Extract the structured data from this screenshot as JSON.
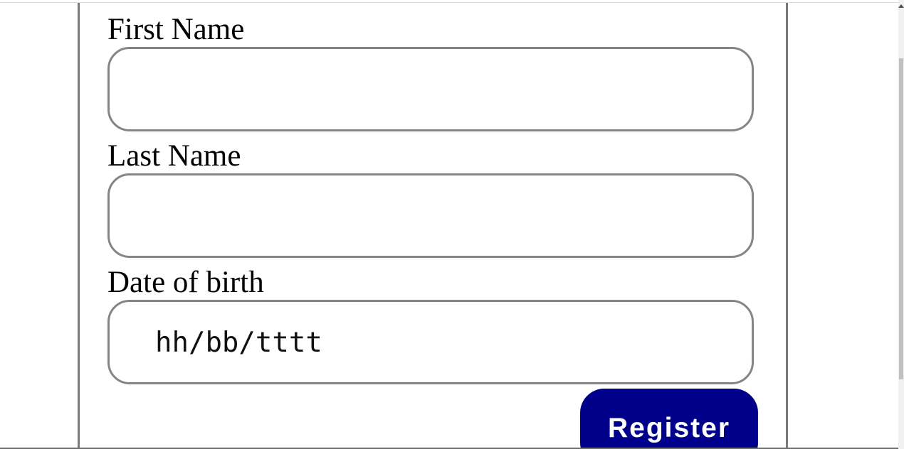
{
  "form": {
    "first_name": {
      "label": "First Name",
      "value": "",
      "placeholder": ""
    },
    "last_name": {
      "label": "Last Name",
      "value": "",
      "placeholder": ""
    },
    "date_of_birth": {
      "label": "Date of birth",
      "display_text": "hh/bb/tttt"
    },
    "register_label": "Register"
  },
  "colors": {
    "button_background": "#00008b",
    "button_text": "#ffffff",
    "input_border": "#858585",
    "panel_border": "#7a7a7a"
  }
}
